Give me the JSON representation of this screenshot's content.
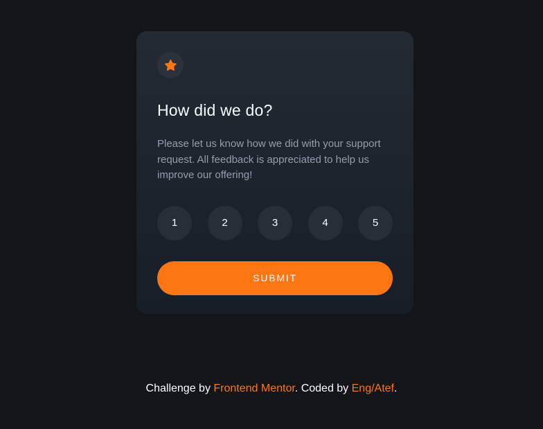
{
  "card": {
    "icon": "star-icon",
    "title": "How did we do?",
    "description": "Please let us know how we did with your support request. All feedback is appreciated to help us improve our offering!",
    "ratings": [
      "1",
      "2",
      "3",
      "4",
      "5"
    ],
    "submit_label": "SUBMIT"
  },
  "footer": {
    "prefix": "Challenge by ",
    "challenge_link": "Frontend Mentor",
    "middle": ". Coded by ",
    "author_link": "Eng/Atef",
    "suffix": "."
  },
  "colors": {
    "accent": "#fc7614",
    "background": "#131518",
    "card": "#232a34",
    "rating_bg": "#262e38",
    "text_muted": "#959eac"
  }
}
